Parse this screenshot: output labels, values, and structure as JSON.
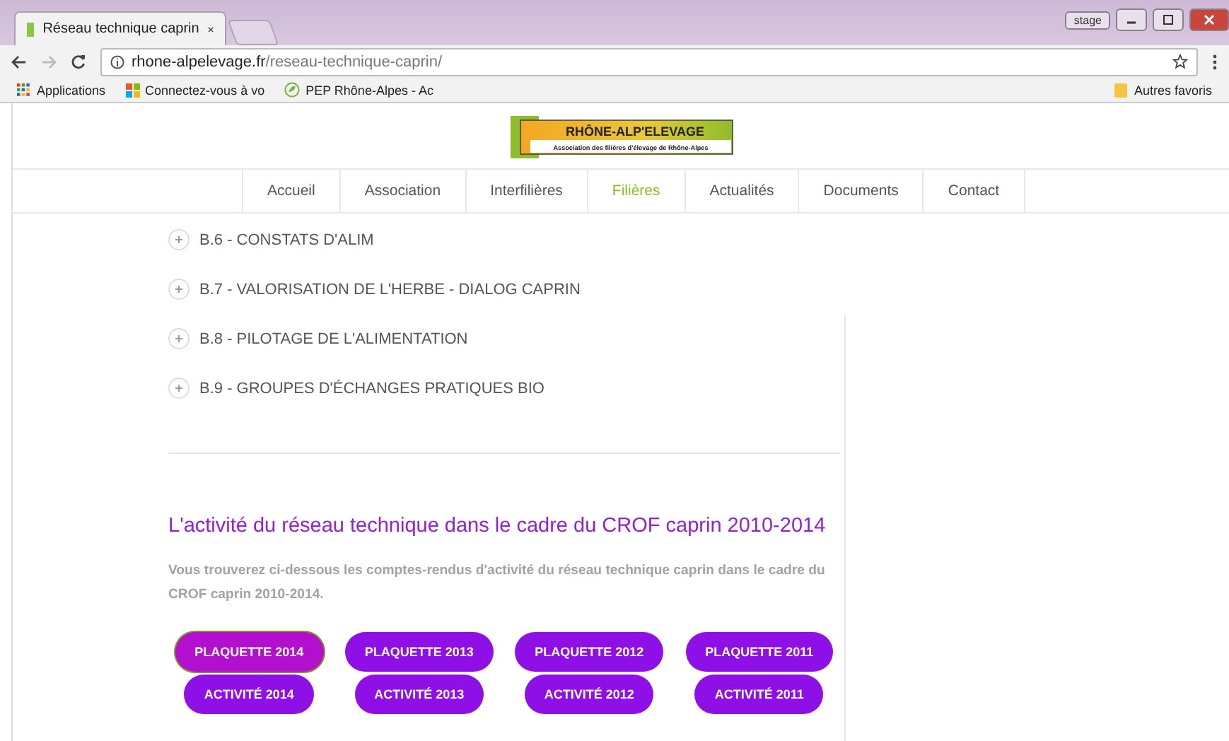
{
  "browser": {
    "tab": {
      "title": "Réseau technique caprin"
    },
    "profile_label": "stage",
    "url": {
      "domain": "rhone-alpelevage.fr",
      "path": "/reseau-technique-caprin/"
    },
    "bookmarks": [
      {
        "label": "Applications",
        "kind": "apps"
      },
      {
        "label": "Connectez-vous à vo",
        "kind": "windows"
      },
      {
        "label": "PEP Rhône-Alpes - Ac",
        "kind": "leaf"
      }
    ],
    "other_bookmarks": "Autres favoris"
  },
  "logo": {
    "title": "RHÔNE-ALP'ELEVAGE",
    "subtitle": "Association des filières d'élevage de Rhône-Alpes"
  },
  "nav": [
    {
      "label": "Accueil",
      "selected": false
    },
    {
      "label": "Association",
      "selected": false
    },
    {
      "label": "Interfilières",
      "selected": false
    },
    {
      "label": "Filières",
      "selected": true
    },
    {
      "label": "Actualités",
      "selected": false
    },
    {
      "label": "Documents",
      "selected": false
    },
    {
      "label": "Contact",
      "selected": false
    }
  ],
  "accordion": [
    {
      "label": "B.6 - CONSTATS D'ALIM"
    },
    {
      "label": "B.7 - VALORISATION DE L'HERBE - DIALOG CAPRIN"
    },
    {
      "label": "B.8 - PILOTAGE DE L'ALIMENTATION"
    },
    {
      "label": "B.9 - GROUPES D'ÉCHANGES PRATIQUES BIO"
    }
  ],
  "section": {
    "heading": "L'activité du réseau technique dans le cadre du CROF caprin 2010-2014",
    "intro": "Vous trouverez ci-dessous les comptes-rendus d'activité du réseau technique caprin dans le cadre du CROF caprin 2010-2014.",
    "buttons": [
      [
        {
          "label": "PLAQUETTE 2014",
          "selected": true
        },
        {
          "label": "ACTIVITÉ 2014",
          "selected": false
        }
      ],
      [
        {
          "label": "PLAQUETTE 2013",
          "selected": false
        },
        {
          "label": "ACTIVITÉ 2013",
          "selected": false
        }
      ],
      [
        {
          "label": "PLAQUETTE 2012",
          "selected": false
        },
        {
          "label": "ACTIVITÉ 2012",
          "selected": false
        }
      ],
      [
        {
          "label": "PLAQUETTE 2011",
          "selected": false
        },
        {
          "label": "ACTIVITÉ 2011",
          "selected": false
        }
      ]
    ]
  }
}
